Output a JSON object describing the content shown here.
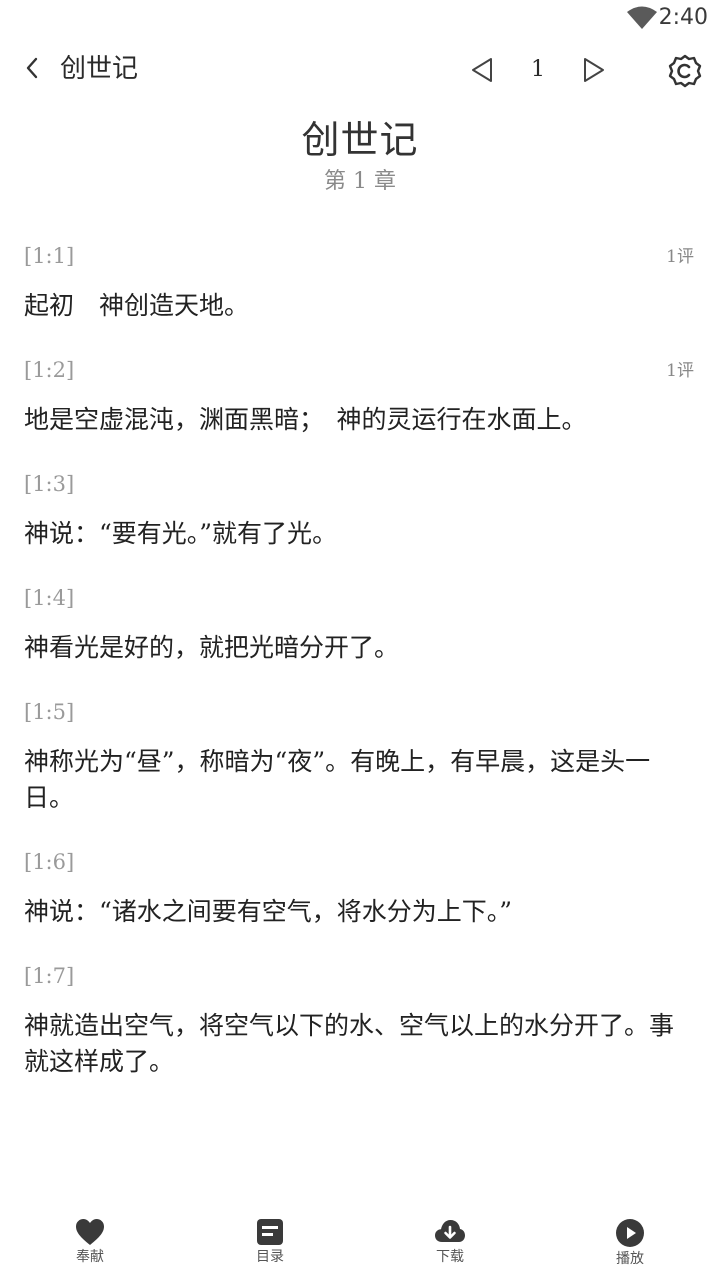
{
  "status_bar": {
    "time": "2:40"
  },
  "top_bar": {
    "title": "创世记",
    "chapter_number": "1"
  },
  "heading": {
    "book": "创世记",
    "chapter": "第 1 章"
  },
  "verses": [
    {
      "ref": "[1:1]",
      "comments": "1评",
      "text": "起初　神创造天地。"
    },
    {
      "ref": "[1:2]",
      "comments": "1评",
      "text": "地是空虚混沌，渊面黑暗；　神的灵运行在水面上。"
    },
    {
      "ref": "[1:3]",
      "comments": "",
      "text": "神说：“要有光。”就有了光。"
    },
    {
      "ref": "[1:4]",
      "comments": "",
      "text": "神看光是好的，就把光暗分开了。"
    },
    {
      "ref": "[1:5]",
      "comments": "",
      "text": "神称光为“昼”，称暗为“夜”。有晚上，有早晨，这是头一日。"
    },
    {
      "ref": "[1:6]",
      "comments": "",
      "text": "神说：“诸水之间要有空气，将水分为上下。”"
    },
    {
      "ref": "[1:7]",
      "comments": "",
      "text": "神就造出空气，将空气以下的水、空气以上的水分开了。事就这样成了。"
    }
  ],
  "bottom_nav": {
    "items": [
      {
        "label": "奉献",
        "icon": "heart-icon"
      },
      {
        "label": "目录",
        "icon": "list-icon"
      },
      {
        "label": "下载",
        "icon": "download-icon"
      },
      {
        "label": "播放",
        "icon": "play-icon"
      }
    ]
  },
  "colors": {
    "icon_dark": "#3a3a3a",
    "text_primary": "#222222",
    "text_muted": "#9a9a9a"
  }
}
